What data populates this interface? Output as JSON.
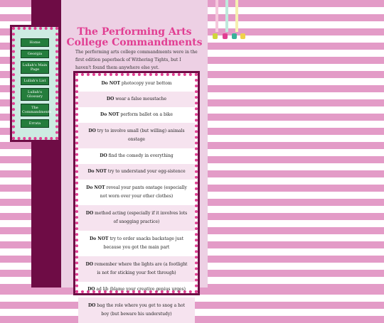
{
  "page": {
    "title": "The Performing Arts College Commandments",
    "intro": "The performing arts college commandments were in the first edition paperback of Withering Tights, but I haven't found them anywhere else yet."
  },
  "nav": {
    "items": [
      "Home",
      "Georgia",
      "Lullah's Main Page",
      "Lullah's List",
      "Lullah's Glossary",
      "The Commandments",
      "Errata"
    ]
  },
  "commandments": [
    {
      "lead": "Do NOT",
      "rest": " photocopy your bottom"
    },
    {
      "lead": "DO",
      "rest": " wear a false moustache"
    },
    {
      "lead": "Do NOT",
      "rest": " perform ballet on a bike"
    },
    {
      "lead": "DO",
      "rest": " try to involve small (but willing) animals onstage"
    },
    {
      "lead": "DO",
      "rest": " find the comedy in everything"
    },
    {
      "lead": "Do NOT",
      "rest": " try to understand your egg-sistence"
    },
    {
      "lead": "Do NOT",
      "rest": " reveal your pants onstage (especially not worn over your other clothes)"
    },
    {
      "lead": "DO",
      "rest": " method acting (especially if it involves lots of snogging practice)"
    },
    {
      "lead": "Do NOT",
      "rest": " try to order snacks backstage just because you got the main part"
    },
    {
      "lead": "DO",
      "rest": " remember where the lights are (a footlight is not for sticking your foot through)"
    },
    {
      "lead": "DO",
      "rest": " ad lib (blame your creative genius urges)"
    },
    {
      "lead": "DO",
      "rest": " bag the role where you get to snog a hot boy (but beware his understudy)"
    }
  ],
  "colors": {
    "accent": "#e13e92",
    "band": "#6e0c45",
    "nav_bg": "#cdebe2",
    "nav_button": "#247d3c",
    "stripe": "#e39bc7"
  },
  "decoration": {
    "lines": [
      "#f5c8dd",
      "#bfe9dd",
      "#f6efb0"
    ],
    "charms": [
      "#cfd63b",
      "#e13e92",
      "#37b39a",
      "#f0d24a"
    ]
  }
}
